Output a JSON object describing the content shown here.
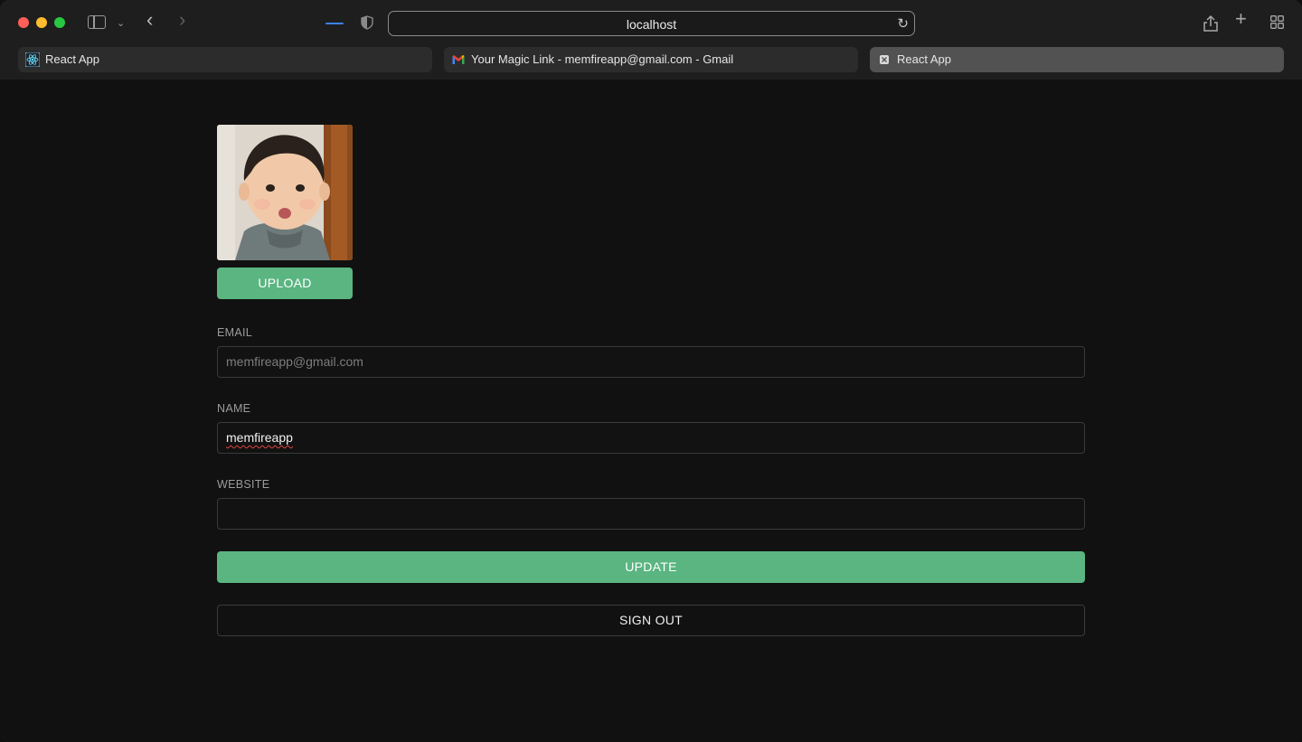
{
  "browser": {
    "url": "localhost",
    "tabs": [
      {
        "label": "React App",
        "icon": "react-icon"
      },
      {
        "label": "Your Magic Link - memfireapp@gmail.com - Gmail",
        "icon": "gmail-icon"
      },
      {
        "label": "React App",
        "icon": "close-icon"
      }
    ]
  },
  "profile": {
    "avatar_icon": "child-photo",
    "upload_label": "UPLOAD",
    "email_label": "EMAIL",
    "email_value": "memfireapp@gmail.com",
    "name_label": "NAME",
    "name_value": "memfireapp",
    "website_label": "WEBSITE",
    "website_value": "",
    "update_label": "UPDATE",
    "signout_label": "SIGN OUT"
  },
  "colors": {
    "accent": "#5ab581",
    "background": "#111111"
  }
}
